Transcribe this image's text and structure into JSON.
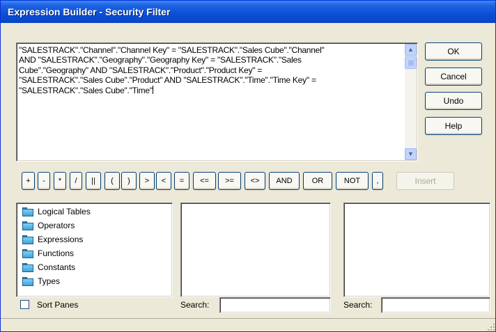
{
  "window": {
    "title": "Expression Builder - Security Filter"
  },
  "expression": {
    "text": "\"SALESTRACK\".\"Channel\".\"Channel Key\" = \"SALESTRACK\".\"Sales Cube\".\"Channel\"\nAND \"SALESTRACK\".\"Geography\".\"Geography Key\" = \"SALESTRACK\".\"Sales\nCube\".\"Geography\" AND \"SALESTRACK\".\"Product\".\"Product Key\" =\n\"SALESTRACK\".\"Sales Cube\".\"Product\" AND \"SALESTRACK\".\"Time\".\"Time Key\" =\n\"SALESTRACK\".\"Sales Cube\".\"Time\""
  },
  "actions": {
    "ok": "OK",
    "cancel": "Cancel",
    "undo": "Undo",
    "help": "Help"
  },
  "operators": [
    "+",
    "-",
    "*",
    "/",
    "||",
    "(",
    ")",
    ">",
    "<",
    "=",
    "<=",
    ">=",
    "<>",
    "AND",
    "OR",
    "NOT",
    ","
  ],
  "insert_label": "Insert",
  "categories": [
    "Logical Tables",
    "Operators",
    "Expressions",
    "Functions",
    "Constants",
    "Types"
  ],
  "sort_panes": {
    "label": "Sort Panes",
    "checked": false
  },
  "search": {
    "label_1": "Search:",
    "label_2": "Search:",
    "value_1": "",
    "value_2": ""
  }
}
